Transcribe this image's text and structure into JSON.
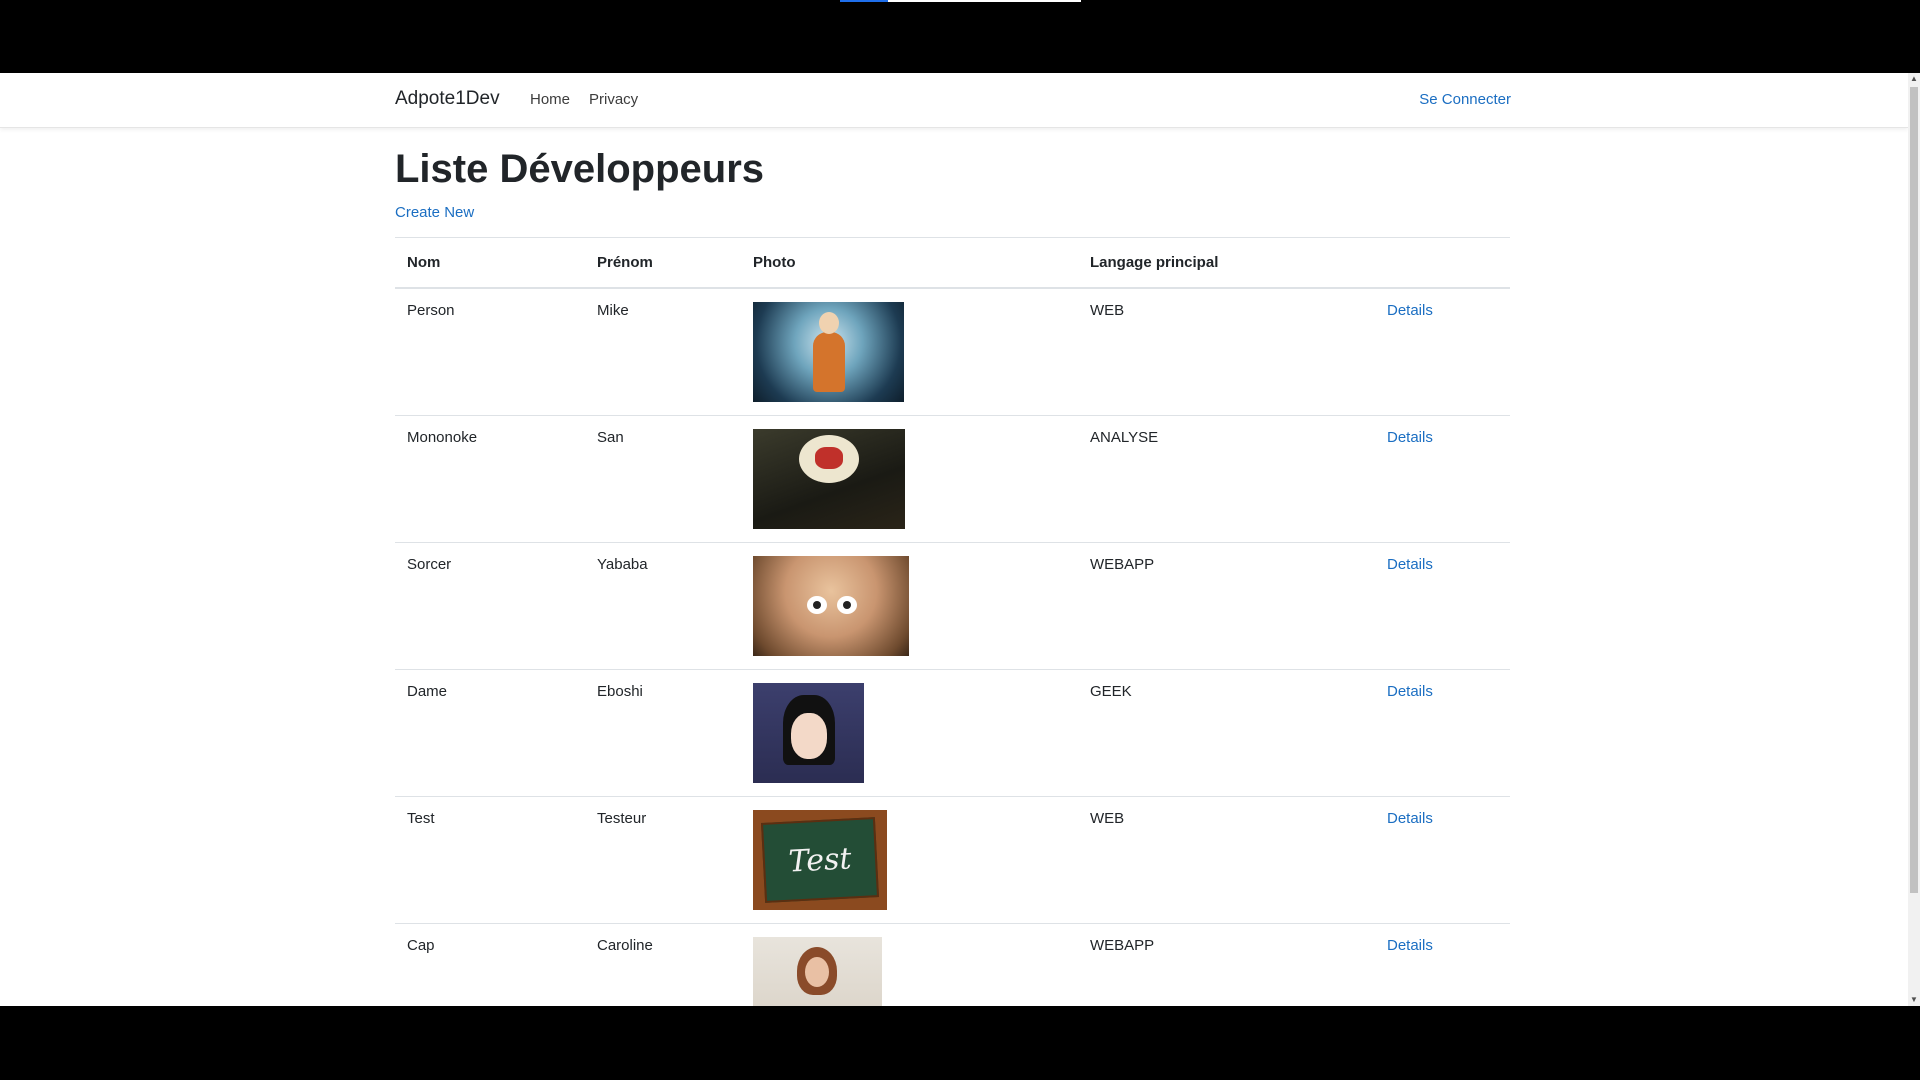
{
  "navbar": {
    "brand": "Adpote1Dev",
    "links": [
      {
        "label": "Home"
      },
      {
        "label": "Privacy"
      }
    ],
    "login": "Se Connecter"
  },
  "page": {
    "title": "Liste Développeurs",
    "create_link": "Create New"
  },
  "table": {
    "headers": [
      "Nom",
      "Prénom",
      "Photo",
      "Langage principal",
      ""
    ],
    "rows": [
      {
        "nom": "Person",
        "prenom": "Mike",
        "photo": "photo-aang",
        "langage": "WEB",
        "action": "Details"
      },
      {
        "nom": "Mononoke",
        "prenom": "San",
        "photo": "photo-san",
        "langage": "ANALYSE",
        "action": "Details"
      },
      {
        "nom": "Sorcer",
        "prenom": "Yababa",
        "photo": "photo-yubaba",
        "langage": "WEBAPP",
        "action": "Details"
      },
      {
        "nom": "Dame",
        "prenom": "Eboshi",
        "photo": "photo-eboshi",
        "langage": "GEEK",
        "action": "Details"
      },
      {
        "nom": "Test",
        "prenom": "Testeur",
        "photo": "photo-test-chalkboard",
        "langage": "WEB",
        "action": "Details",
        "photo_text": "Test"
      },
      {
        "nom": "Cap",
        "prenom": "Caroline",
        "photo": "photo-caroline",
        "langage": "WEBAPP",
        "action": "Details"
      }
    ]
  },
  "colors": {
    "link": "#1b6ec2",
    "text": "#212529",
    "border": "#dee2e6"
  }
}
